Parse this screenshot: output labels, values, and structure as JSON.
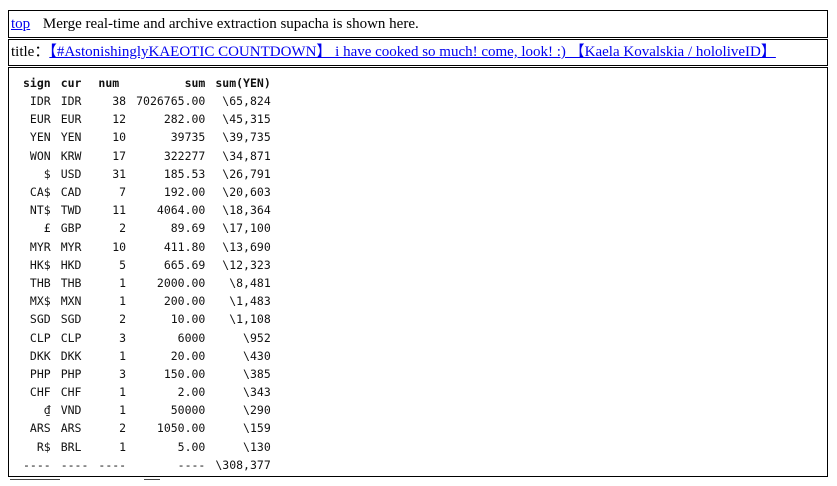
{
  "top_line": {
    "link": "top",
    "text": "Merge real-time and archive extraction supacha is shown here."
  },
  "title_line": {
    "label": "title：",
    "link": "【#AstonishinglyKAEOTIC COUNTDOWN】 i have cooked so much! come, look! :) 【Kaela Kovalskia / hololiveID】"
  },
  "table": {
    "headers": [
      "sign",
      "cur",
      "num",
      "sum",
      "sum(YEN)"
    ],
    "rows": [
      [
        "IDR",
        "IDR",
        "38",
        "7026765.00",
        "\\65,824"
      ],
      [
        "EUR",
        "EUR",
        "12",
        "282.00",
        "\\45,315"
      ],
      [
        "YEN",
        "YEN",
        "10",
        "39735",
        "\\39,735"
      ],
      [
        "WON",
        "KRW",
        "17",
        "322277",
        "\\34,871"
      ],
      [
        "$",
        "USD",
        "31",
        "185.53",
        "\\26,791"
      ],
      [
        "CA$",
        "CAD",
        "7",
        "192.00",
        "\\20,603"
      ],
      [
        "NT$",
        "TWD",
        "11",
        "4064.00",
        "\\18,364"
      ],
      [
        "£",
        "GBP",
        "2",
        "89.69",
        "\\17,100"
      ],
      [
        "MYR",
        "MYR",
        "10",
        "411.80",
        "\\13,690"
      ],
      [
        "HK$",
        "HKD",
        "5",
        "665.69",
        "\\12,323"
      ],
      [
        "THB",
        "THB",
        "1",
        "2000.00",
        "\\8,481"
      ],
      [
        "MX$",
        "MXN",
        "1",
        "200.00",
        "\\1,483"
      ],
      [
        "SGD",
        "SGD",
        "2",
        "10.00",
        "\\1,108"
      ],
      [
        "CLP",
        "CLP",
        "3",
        "6000",
        "\\952"
      ],
      [
        "DKK",
        "DKK",
        "1",
        "20.00",
        "\\430"
      ],
      [
        "PHP",
        "PHP",
        "3",
        "150.00",
        "\\385"
      ],
      [
        "CHF",
        "CHF",
        "1",
        "2.00",
        "\\343"
      ],
      [
        "₫",
        "VND",
        "1",
        "50000",
        "\\290"
      ],
      [
        "ARS",
        "ARS",
        "2",
        "1050.00",
        "\\159"
      ],
      [
        "R$",
        "BRL",
        "1",
        "5.00",
        "\\130"
      ]
    ],
    "footer": [
      "----",
      "----",
      "----",
      "----",
      "\\308,377"
    ]
  }
}
